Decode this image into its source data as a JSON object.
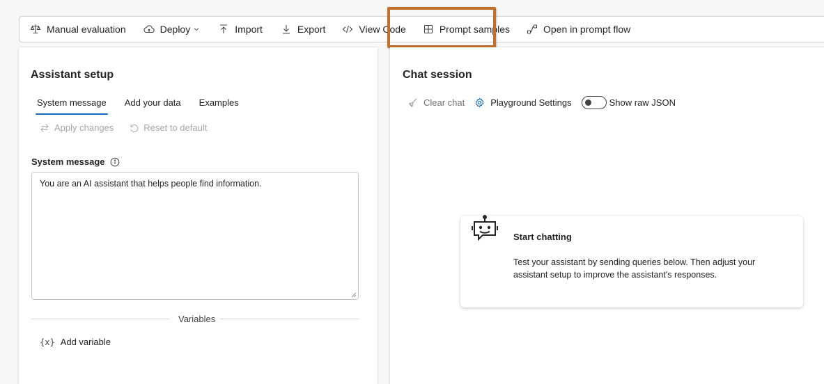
{
  "toolbar": {
    "manual_evaluation": "Manual evaluation",
    "deploy": "Deploy",
    "import": "Import",
    "export": "Export",
    "view_code": "View Code",
    "prompt_samples": "Prompt samples",
    "open_prompt_flow": "Open in prompt flow"
  },
  "assistant_setup": {
    "title": "Assistant setup",
    "tabs": [
      {
        "label": "System message",
        "active": true
      },
      {
        "label": "Add your data",
        "active": false
      },
      {
        "label": "Examples",
        "active": false
      }
    ],
    "apply_changes": "Apply changes",
    "reset_default": "Reset to default",
    "system_message_label": "System message",
    "system_message_value": "You are an AI assistant that helps people find information.",
    "variables_label": "Variables",
    "variable_brace": "{x}",
    "add_variable": "Add variable"
  },
  "chat_session": {
    "title": "Chat session",
    "clear_chat": "Clear chat",
    "playground_settings": "Playground Settings",
    "show_raw_json": "Show raw JSON",
    "show_raw_json_on": false,
    "start_title": "Start chatting",
    "start_description": "Test your assistant by sending queries below. Then adjust your assistant setup to improve the assistant's responses."
  },
  "colors": {
    "accent": "#0f6cbd",
    "highlight": "#c0702a"
  }
}
